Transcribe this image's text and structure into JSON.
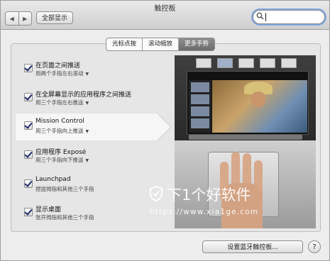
{
  "window": {
    "title": "触控板"
  },
  "toolbar": {
    "show_all_label": "全部显示",
    "back_glyph": "◀",
    "forward_glyph": "▶",
    "search_placeholder": ""
  },
  "tabs": [
    {
      "label": "光标点按",
      "active": false
    },
    {
      "label": "滚动缩放",
      "active": false
    },
    {
      "label": "更多手势",
      "active": true
    }
  ],
  "options": [
    {
      "title": "在页面之间推送",
      "subtitle": "用两个手指左右滚动",
      "checked": true,
      "dropdown": true
    },
    {
      "title": "在全屏幕显示的应用程序之间推送",
      "subtitle": "用三个手指左右推送",
      "checked": true,
      "dropdown": true
    },
    {
      "title": "Mission Control",
      "subtitle": "用三个手指向上推送",
      "checked": true,
      "dropdown": true,
      "selected": true
    },
    {
      "title": "应用程序 Exposé",
      "subtitle": "用三个手指向下推送",
      "checked": true,
      "dropdown": true
    },
    {
      "title": "Launchpad",
      "subtitle": "捏拢拇指和其他三个手指",
      "checked": true,
      "dropdown": false
    },
    {
      "title": "显示桌面",
      "subtitle": "张开拇指和其他三个手指",
      "checked": true,
      "dropdown": false
    }
  ],
  "footer": {
    "setup_bluetooth_label": "设置蓝牙触控板...",
    "help_label": "?"
  },
  "watermark": {
    "text": "下1个好软件",
    "url": "https://www.xia1ge.com"
  },
  "colors": {
    "active_tab": "#7a7a7a",
    "focus_ring": "#7fa7e0"
  }
}
